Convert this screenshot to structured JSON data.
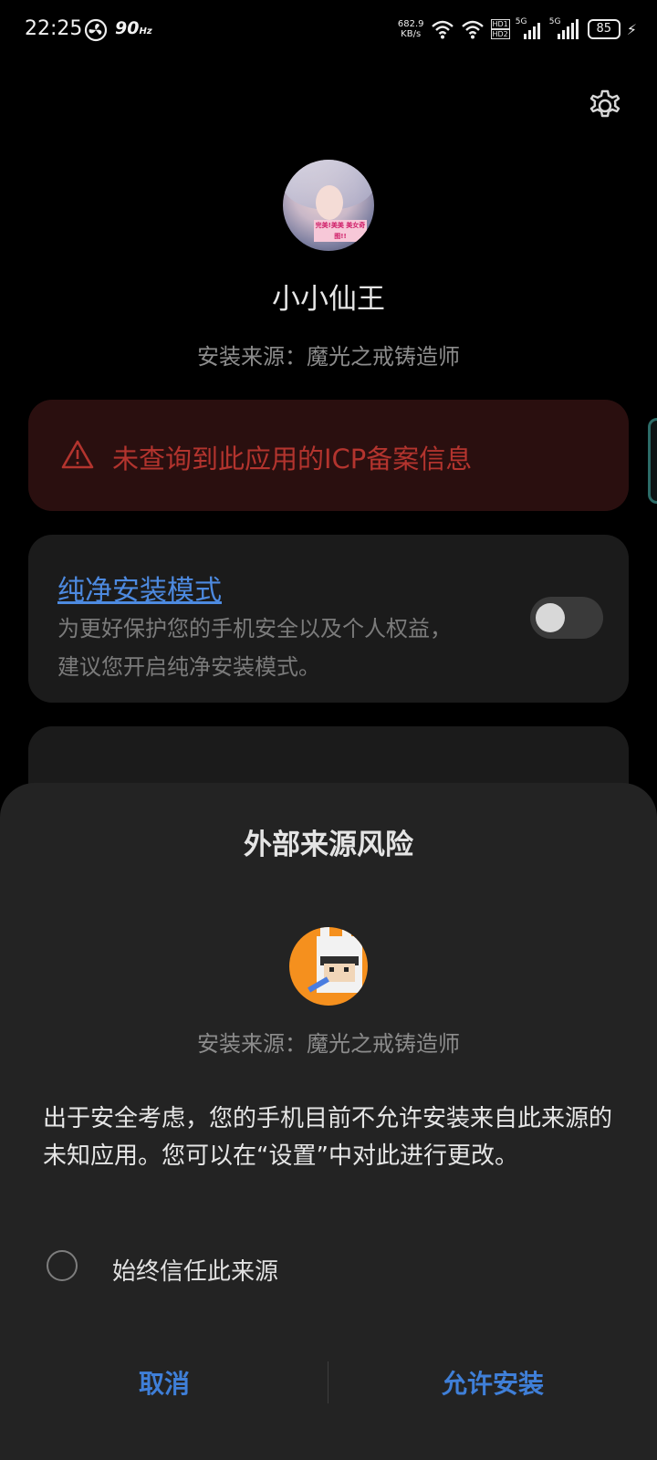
{
  "status_bar": {
    "time": "22:25",
    "refresh_rate": "90",
    "refresh_rate_unit": "Hz",
    "net_speed_value": "682.9",
    "net_speed_unit": "KB/s",
    "hd1": "HD1",
    "hd2": "HD2",
    "sim1": "5G",
    "sim2": "5G",
    "battery": "85",
    "icons": [
      "fan-icon",
      "wifi-icon",
      "wifi-icon",
      "hd-icon",
      "signal-icon",
      "signal-icon",
      "battery-icon",
      "charging-icon"
    ]
  },
  "header": {
    "settings_icon": "gear-icon"
  },
  "app": {
    "name": "小小仙王",
    "install_source": "安装来源：魔光之戒铸造师",
    "icon_text": "完美!美美 美女奇图!!"
  },
  "warning": {
    "icon": "warning-triangle-icon",
    "text": "未查询到此应用的ICP备案信息",
    "color": "#b3342e"
  },
  "pure_mode": {
    "title": "纯净安装模式",
    "description": "为更好保护您的手机安全以及个人权益，建议您开启纯净安装模式。",
    "toggle_on": false
  },
  "dialog": {
    "title": "外部来源风险",
    "source_icon": "bunny-avatar-icon",
    "install_source": "安装来源：魔光之戒铸造师",
    "message": "出于安全考虑，您的手机目前不允许安装来自此来源的未知应用。您可以在“设置”中对此进行更改。",
    "trust_label": "始终信任此来源",
    "trust_checked": false,
    "cancel_label": "取消",
    "allow_label": "允许安装",
    "accent": "#3f7fd8"
  }
}
